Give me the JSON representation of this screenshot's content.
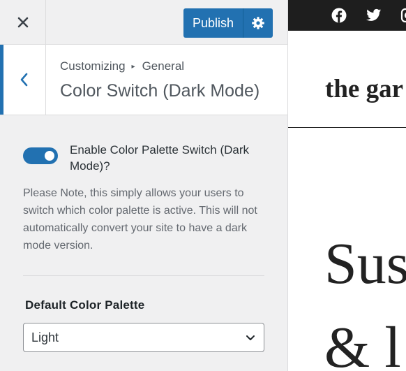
{
  "customizer": {
    "publish_label": "Publish",
    "breadcrumb": {
      "root": "Customizing",
      "separator": "▸",
      "current": "General"
    },
    "section_title": "Color Switch (Dark Mode)",
    "toggle": {
      "label": "Enable Color Palette Switch (Dark Mode)?",
      "checked": true
    },
    "note": "Please Note, this simply allows your users to switch which color palette is active. This will not automatically convert your site to have a dark mode version.",
    "palette": {
      "label": "Default Color Palette",
      "selected": "Light"
    }
  },
  "preview": {
    "social_icons": [
      "facebook-icon",
      "twitter-icon",
      "instagram-icon"
    ],
    "site_title": "the gar",
    "hero_line_1": "Sus",
    "hero_line_2": "& l"
  },
  "colors": {
    "accent": "#2271b1",
    "sidebar_bg": "#f0f0f1",
    "social_bar_bg": "#1e1e1e"
  }
}
